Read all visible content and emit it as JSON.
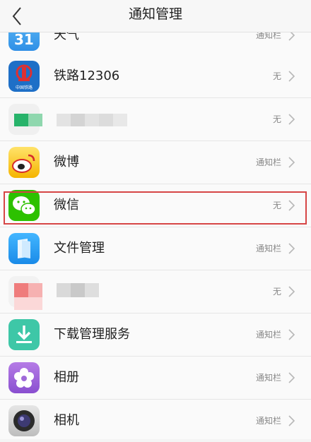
{
  "header": {
    "title": "通知管理"
  },
  "rows": [
    {
      "label": "天气",
      "status": "通知栏",
      "icon": "weather-icon"
    },
    {
      "label": "铁路12306",
      "status": "无",
      "icon": "railway-icon"
    },
    {
      "label": "",
      "status": "无",
      "icon": "blurred-app-icon"
    },
    {
      "label": "微博",
      "status": "通知栏",
      "icon": "weibo-icon"
    },
    {
      "label": "微信",
      "status": "无",
      "icon": "wechat-icon"
    },
    {
      "label": "文件管理",
      "status": "通知栏",
      "icon": "file-manager-icon"
    },
    {
      "label": "",
      "status": "无",
      "icon": "blurred-app-icon"
    },
    {
      "label": "下载管理服务",
      "status": "通知栏",
      "icon": "download-icon"
    },
    {
      "label": "相册",
      "status": "通知栏",
      "icon": "gallery-icon"
    },
    {
      "label": "相机",
      "status": "通知栏",
      "icon": "camera-icon"
    }
  ],
  "railway_icon_caption": "中国铁路",
  "weather_icon_text": "31",
  "colors": {
    "highlight": "#d64545",
    "wechat": "#2dc100",
    "download": "#3ec7a7"
  }
}
